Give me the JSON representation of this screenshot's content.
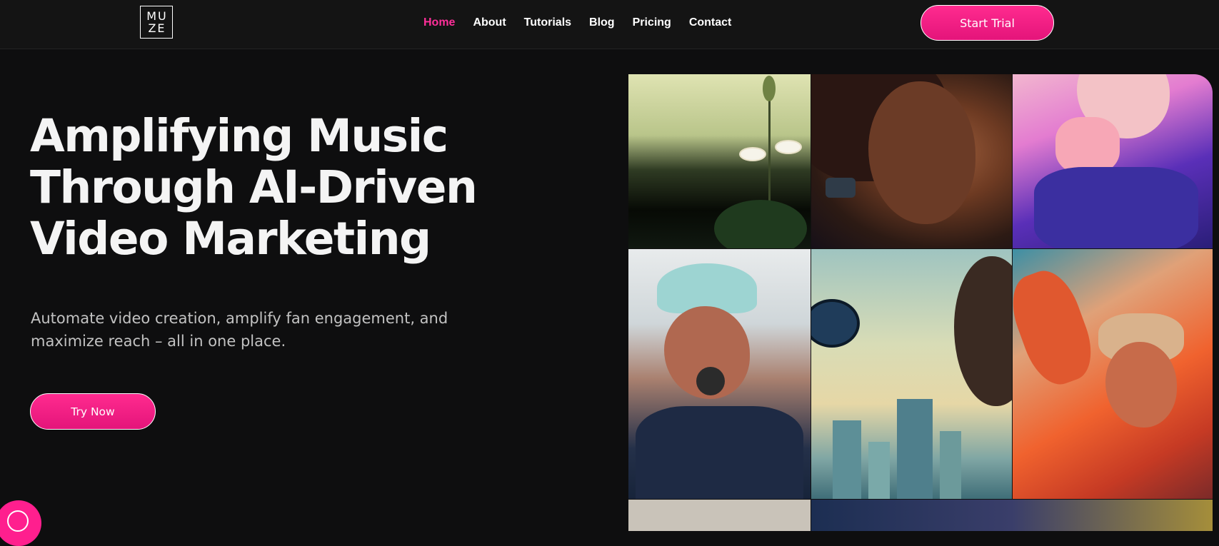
{
  "header": {
    "logo_line1": "MU",
    "logo_line2": "ZE",
    "nav": [
      "Home",
      "About",
      "Tutorials",
      "Blog",
      "Pricing",
      "Contact"
    ],
    "active_nav": "Home",
    "cta_label": "Start Trial"
  },
  "hero": {
    "title": "Amplifying Music Through AI-Driven Video Marketing",
    "subtitle": "Automate video creation, amplify fan engagement, and maximize reach – all in one place.",
    "cta_label": "Try Now"
  },
  "colors": {
    "background": "#0e0e0f",
    "header_bg": "#141414",
    "accent": "#ff2f9a",
    "button_gradient_top": "#ff2b8f",
    "button_gradient_bottom": "#e4147a",
    "subtitle_text": "#c2c2c2"
  },
  "icons": {
    "chat": "chat-bubble-icon"
  }
}
